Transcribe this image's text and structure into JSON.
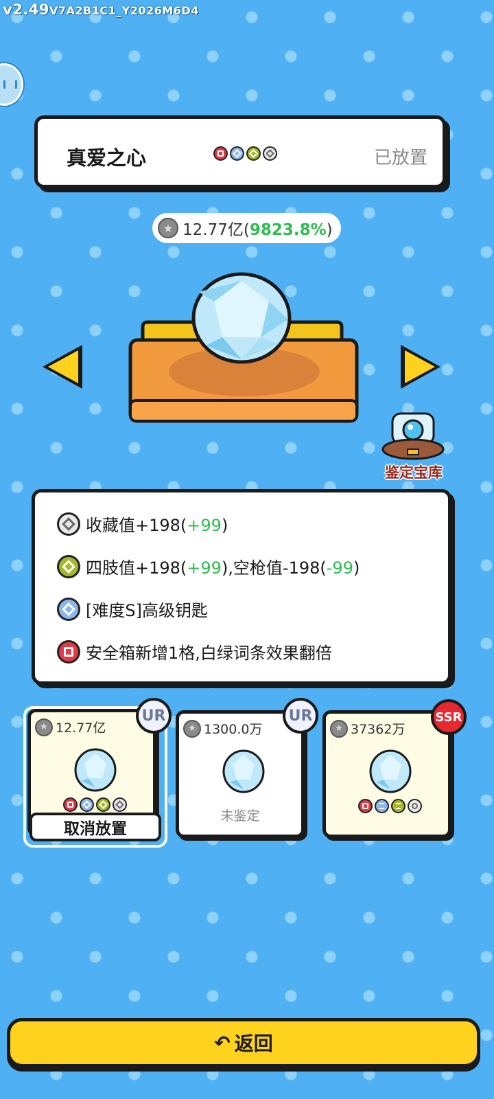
{
  "version": {
    "major": "v2.49",
    "build": "V7A2B1C1_Y2026M6D4"
  },
  "header": {
    "name": "真爱之心",
    "status": "已放置"
  },
  "value": {
    "amount": "12.77亿(",
    "percent": "9823.8%",
    "close": ")"
  },
  "vault": {
    "label": "鉴定宝库"
  },
  "effects": [
    {
      "icon": "gray",
      "text": "收藏值+198(",
      "delta": "+99",
      "end": ")"
    },
    {
      "icon": "green",
      "text": "四肢值+198(",
      "delta": "+99",
      "mid": "),空枪值-198(",
      "delta2": "-99",
      "end": ")"
    },
    {
      "icon": "blue",
      "text": "[难度S]高级钥匙"
    },
    {
      "icon": "red",
      "text": "安全箱新增1格,白绿词条效果翻倍"
    }
  ],
  "items": [
    {
      "price": "12.77亿",
      "rarity": "UR",
      "action": "取消放置",
      "selected": true
    },
    {
      "price": "1300.0万",
      "rarity": "UR",
      "status": "未鉴定"
    },
    {
      "price": "37362万",
      "rarity": "SSR"
    }
  ],
  "footer": {
    "back_label": "返回"
  },
  "colors": {
    "background": "#4fb1f4",
    "accent": "#ffd21e",
    "positive": "#2ebd4f"
  }
}
